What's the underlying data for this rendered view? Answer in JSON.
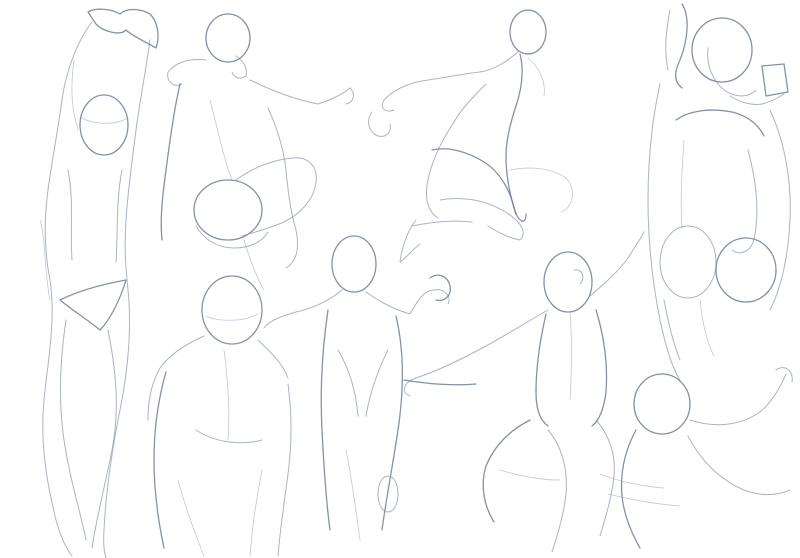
{
  "canvas": {
    "background": "#ffffff",
    "stroke_color": "#8e9bb2",
    "stroke_color_dark": "#6f7e99"
  },
  "figures": [
    {
      "name": "standing-figure-arms-raised-left"
    },
    {
      "name": "crouching-figure-back-view"
    },
    {
      "name": "jumping-figure-kneeling-pose"
    },
    {
      "name": "standing-figure-back-arm-raised-right"
    },
    {
      "name": "figure-back-view-lower-left"
    },
    {
      "name": "figure-front-arm-extended-center"
    },
    {
      "name": "figure-back-view-reaching-center-right"
    },
    {
      "name": "figure-partial-arm-raised-bottom-right"
    }
  ]
}
